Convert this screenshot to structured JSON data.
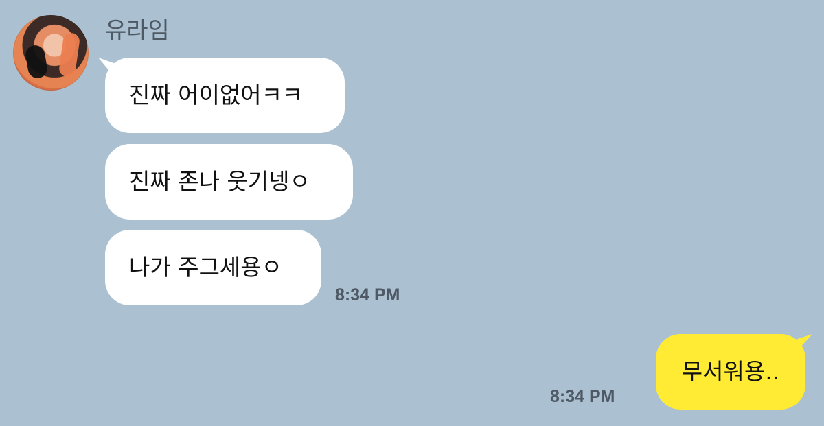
{
  "chat": {
    "sender_name": "유라임",
    "incoming_messages": [
      {
        "text": "진짜 어이없어ㅋㅋ"
      },
      {
        "text": "진짜 존나 웃기넹ㅇ"
      },
      {
        "text": "나가 주그세용ㅇ"
      }
    ],
    "incoming_time": "8:34 PM",
    "outgoing_message": {
      "text": "무서워용.."
    },
    "outgoing_time": "8:34 PM"
  }
}
